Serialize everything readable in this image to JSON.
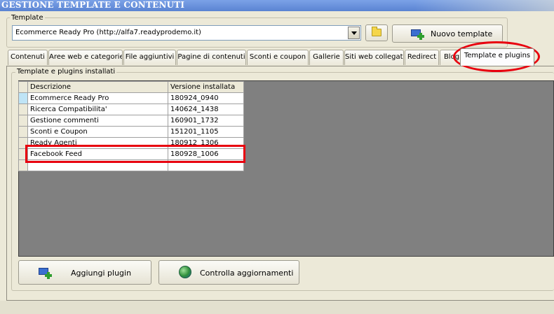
{
  "window": {
    "title": "GESTIONE TEMPLATE E CONTENUTI"
  },
  "template_group": {
    "label": "Template",
    "selected": "Ecommerce Ready Pro (http://alfa7.readyprodemo.it)",
    "new_template_label": "Nuovo template"
  },
  "tabs": [
    {
      "label": "Contenuti",
      "active": false
    },
    {
      "label": "Aree web e categorie",
      "active": false
    },
    {
      "label": "File aggiuntivi",
      "active": false
    },
    {
      "label": "Pagine di contenuti",
      "active": false
    },
    {
      "label": "Sconti e coupon",
      "active": false
    },
    {
      "label": "Gallerie",
      "active": false
    },
    {
      "label": "Siti web collegati",
      "active": false
    },
    {
      "label": "Redirect",
      "active": false
    },
    {
      "label": "Blog",
      "active": false
    },
    {
      "label": "Template e plugins",
      "active": true
    }
  ],
  "plugins_group": {
    "label": "Template e plugins installati"
  },
  "table": {
    "headers": [
      "Descrizione",
      "Versione installata"
    ],
    "rows": [
      [
        "Ecommerce Ready Pro",
        "180924_0940"
      ],
      [
        "Ricerca Compatibilita'",
        "140624_1438"
      ],
      [
        "Gestione commenti",
        "160901_1732"
      ],
      [
        "Sconti e Coupon",
        "151201_1105"
      ],
      [
        "Ready Agenti",
        "180912_1306"
      ],
      [
        "Facebook Feed",
        "180928_1006"
      ],
      [
        "",
        ""
      ]
    ]
  },
  "buttons": {
    "add_plugin": "Aggiungi plugin",
    "check_updates": "Controlla aggiornamenti"
  },
  "icons": {
    "folder": "folder-icon",
    "new_template": "monitor-plus-icon",
    "add_plugin": "monitor-plus-icon",
    "check_updates": "globe-arrow-icon"
  },
  "colors": {
    "highlight": "#e8000f",
    "window_bg": "#ece9d8",
    "grid_empty_bg": "#808080"
  }
}
